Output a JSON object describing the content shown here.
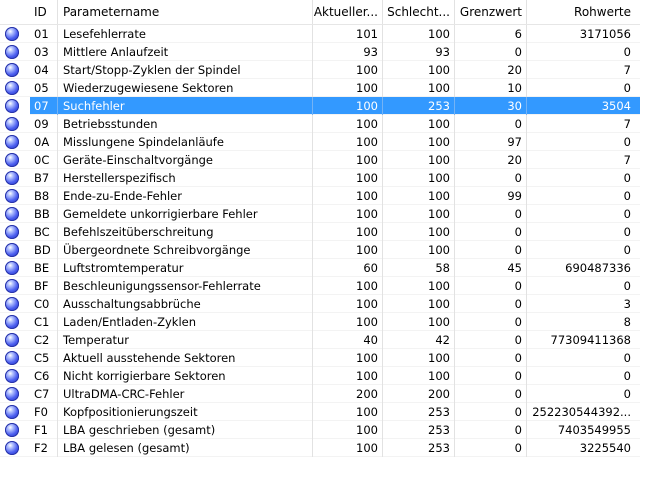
{
  "columns": {
    "id": "ID",
    "name": "Parametername",
    "current": "Aktueller...",
    "worst": "Schlecht...",
    "threshold": "Grenzwert",
    "raw": "Rohwerte"
  },
  "status_icon": "status-ok-icon",
  "selected_row": "07",
  "colors": {
    "selection": "#3399ff",
    "status_ball": "#4c5ff0"
  },
  "rows": [
    {
      "id": "01",
      "name": "Lesefehlerrate",
      "current": "101",
      "worst": "100",
      "threshold": "6",
      "raw": "3171056"
    },
    {
      "id": "03",
      "name": "Mittlere Anlaufzeit",
      "current": "93",
      "worst": "93",
      "threshold": "0",
      "raw": "0"
    },
    {
      "id": "04",
      "name": "Start/Stopp-Zyklen der Spindel",
      "current": "100",
      "worst": "100",
      "threshold": "20",
      "raw": "7"
    },
    {
      "id": "05",
      "name": "Wiederzugewiesene Sektoren",
      "current": "100",
      "worst": "100",
      "threshold": "10",
      "raw": "0"
    },
    {
      "id": "07",
      "name": "Suchfehler",
      "current": "100",
      "worst": "253",
      "threshold": "30",
      "raw": "3504"
    },
    {
      "id": "09",
      "name": "Betriebsstunden",
      "current": "100",
      "worst": "100",
      "threshold": "0",
      "raw": "7"
    },
    {
      "id": "0A",
      "name": "Misslungene Spindelanläufe",
      "current": "100",
      "worst": "100",
      "threshold": "97",
      "raw": "0"
    },
    {
      "id": "0C",
      "name": "Geräte-Einschaltvorgänge",
      "current": "100",
      "worst": "100",
      "threshold": "20",
      "raw": "7"
    },
    {
      "id": "B7",
      "name": "Herstellerspezifisch",
      "current": "100",
      "worst": "100",
      "threshold": "0",
      "raw": "0"
    },
    {
      "id": "B8",
      "name": "Ende-zu-Ende-Fehler",
      "current": "100",
      "worst": "100",
      "threshold": "99",
      "raw": "0"
    },
    {
      "id": "BB",
      "name": "Gemeldete unkorrigierbare Fehler",
      "current": "100",
      "worst": "100",
      "threshold": "0",
      "raw": "0"
    },
    {
      "id": "BC",
      "name": "Befehlszeitüberschreitung",
      "current": "100",
      "worst": "100",
      "threshold": "0",
      "raw": "0"
    },
    {
      "id": "BD",
      "name": "Übergeordnete Schreibvorgänge",
      "current": "100",
      "worst": "100",
      "threshold": "0",
      "raw": "0"
    },
    {
      "id": "BE",
      "name": "Luftstromtemperatur",
      "current": "60",
      "worst": "58",
      "threshold": "45",
      "raw": "690487336"
    },
    {
      "id": "BF",
      "name": "Beschleunigungssensor-Fehlerrate",
      "current": "100",
      "worst": "100",
      "threshold": "0",
      "raw": "0"
    },
    {
      "id": "C0",
      "name": "Ausschaltungsabbrüche",
      "current": "100",
      "worst": "100",
      "threshold": "0",
      "raw": "3"
    },
    {
      "id": "C1",
      "name": "Laden/Entladen-Zyklen",
      "current": "100",
      "worst": "100",
      "threshold": "0",
      "raw": "8"
    },
    {
      "id": "C2",
      "name": "Temperatur",
      "current": "40",
      "worst": "42",
      "threshold": "0",
      "raw": "77309411368"
    },
    {
      "id": "C5",
      "name": "Aktuell ausstehende Sektoren",
      "current": "100",
      "worst": "100",
      "threshold": "0",
      "raw": "0"
    },
    {
      "id": "C6",
      "name": "Nicht korrigierbare Sektoren",
      "current": "100",
      "worst": "100",
      "threshold": "0",
      "raw": "0"
    },
    {
      "id": "C7",
      "name": "UltraDMA-CRC-Fehler",
      "current": "200",
      "worst": "200",
      "threshold": "0",
      "raw": "0"
    },
    {
      "id": "F0",
      "name": "Kopfpositionierungszeit",
      "current": "100",
      "worst": "253",
      "threshold": "0",
      "raw": "252230544392..."
    },
    {
      "id": "F1",
      "name": "LBA geschrieben (gesamt)",
      "current": "100",
      "worst": "253",
      "threshold": "0",
      "raw": "7403549955"
    },
    {
      "id": "F2",
      "name": "LBA gelesen (gesamt)",
      "current": "100",
      "worst": "253",
      "threshold": "0",
      "raw": "3225540"
    }
  ]
}
